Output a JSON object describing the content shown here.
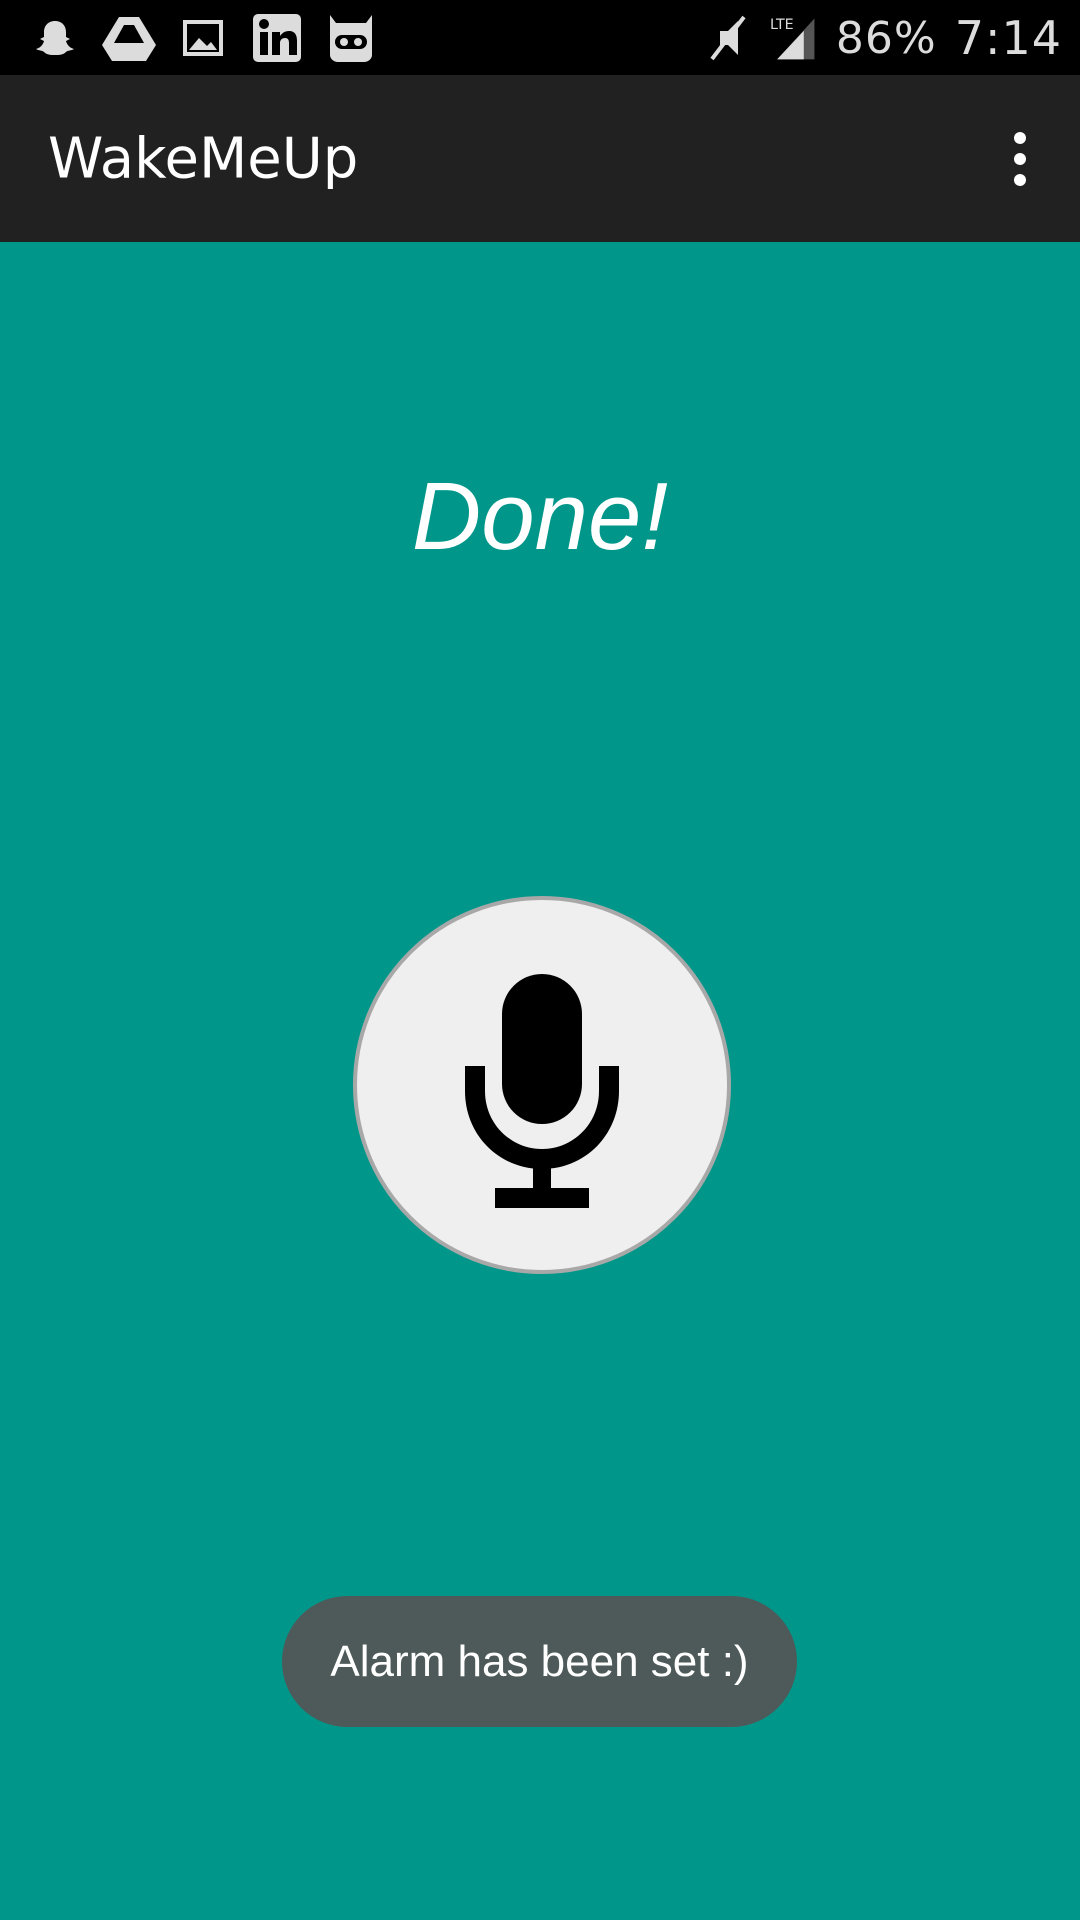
{
  "status_bar": {
    "left_icons": [
      "snapchat-icon",
      "google-drive-icon",
      "gallery-icon",
      "linkedin-icon",
      "cyanogenmod-icon"
    ],
    "right_icons": [
      "mute-icon",
      "lte-signal-icon"
    ],
    "network_label": "LTE",
    "battery": "86%",
    "time": "7:14"
  },
  "action_bar": {
    "title": "WakeMeUp",
    "menu_icon": "overflow-menu-icon"
  },
  "main": {
    "status_message": "Done!",
    "mic_button_icon": "microphone-icon"
  },
  "toast": {
    "message": "Alarm has been set :)"
  },
  "colors": {
    "background": "#00978a",
    "action_bar": "#212121",
    "status_bar": "#000000",
    "mic_button": "#efefef",
    "toast": "#4e5a59"
  }
}
